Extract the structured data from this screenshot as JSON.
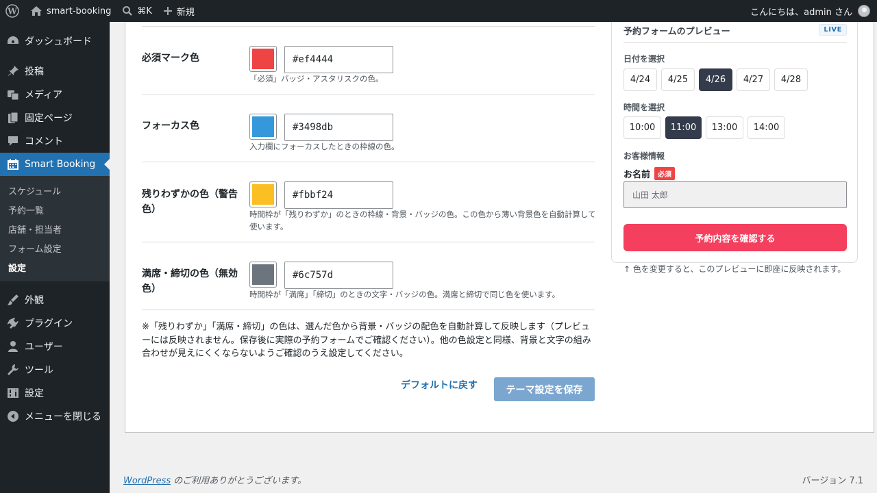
{
  "adminbar": {
    "site_name": "smart-booking",
    "search_shortcut": "⌘K",
    "new_label": "新規",
    "greeting": "こんにちは、admin さん"
  },
  "sidebar": {
    "items_top": [
      {
        "label": "ダッシュボード",
        "icon": "dashboard-icon"
      },
      {
        "label": "投稿",
        "icon": "pin-icon"
      },
      {
        "label": "メディア",
        "icon": "media-icon"
      },
      {
        "label": "固定ページ",
        "icon": "page-icon"
      },
      {
        "label": "コメント",
        "icon": "comment-icon"
      },
      {
        "label": "Smart Booking",
        "icon": "calendar-icon"
      }
    ],
    "submenu": [
      "スケジュール",
      "予約一覧",
      "店舗・担当者",
      "フォーム設定",
      "設定"
    ],
    "items_bottom": [
      {
        "label": "外観",
        "icon": "appearance-icon"
      },
      {
        "label": "プラグイン",
        "icon": "plugin-icon"
      },
      {
        "label": "ユーザー",
        "icon": "user-icon"
      },
      {
        "label": "ツール",
        "icon": "wrench-icon"
      },
      {
        "label": "設定",
        "icon": "settings-icon"
      },
      {
        "label": "メニューを閉じる",
        "icon": "collapse-icon"
      }
    ]
  },
  "settings": {
    "rows": [
      {
        "label": "必須マーク色",
        "value": "#ef4444",
        "desc": "「必須」バッジ・アスタリスクの色。"
      },
      {
        "label": "フォーカス色",
        "value": "#3498db",
        "desc": "入力欄にフォーカスしたときの枠線の色。"
      },
      {
        "label": "残りわずかの色（警告色）",
        "value": "#fbbf24",
        "desc": "時間枠が「残りわずか」のときの枠線・背景・バッジの色。この色から薄い背景色を自動計算して使います。"
      },
      {
        "label": "満席・締切の色（無効色）",
        "value": "#6c757d",
        "desc": "時間枠が「満席」「締切」のときの文字・バッジの色。満席と締切で同じ色を使います。"
      }
    ],
    "note": "※「残りわずか」「満席・締切」の色は、選んだ色から背景・バッジの配色を自動計算して反映します（プレビューには反映されません。保存後に実際の予約フォームでご確認ください）。他の色設定と同様、背景と文字の組み合わせが見えにくくならないようご確認のうえ設定してください。",
    "reset_label": "デフォルトに戻す",
    "save_label": "テーマ設定を保存"
  },
  "preview": {
    "title": "予約フォームのプレビュー",
    "live_badge": "LIVE",
    "date_label": "日付を選択",
    "dates": [
      "4/24",
      "4/25",
      "4/26",
      "4/27",
      "4/28"
    ],
    "time_label": "時間を選択",
    "times": [
      "10:00",
      "11:00",
      "13:00",
      "14:00"
    ],
    "customer_label": "お客様情報",
    "name_label": "お名前",
    "required_badge": "必須",
    "name_placeholder": "山田 太郎",
    "submit_label": "予約内容を確認する",
    "footnote": "↑ 色を変更すると、このプレビューに即座に反映されます。"
  },
  "footer": {
    "link_text": "WordPress",
    "text": " のご利用ありがとうございます。",
    "version": "バージョン 7.1"
  }
}
